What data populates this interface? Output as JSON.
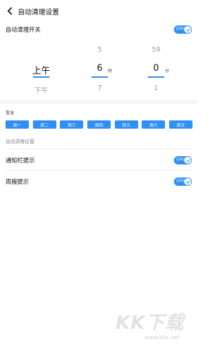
{
  "header": {
    "title": "自动清理设置",
    "back_icon": "chevron-left-icon"
  },
  "auto_clean": {
    "label": "自动清理开关",
    "toggle_text": "已开启",
    "enabled": true
  },
  "picker": {
    "period": {
      "above": "",
      "selected": "上午",
      "below": "下午"
    },
    "hour": {
      "above": "5",
      "selected": "6",
      "below": "7",
      "unit": "时"
    },
    "minute": {
      "above": "59",
      "selected": "0",
      "below": "1",
      "unit": "分"
    }
  },
  "repeat": {
    "label": "重复",
    "days": [
      "周一",
      "周二",
      "周三",
      "周四",
      "周五",
      "周六",
      "周日"
    ]
  },
  "section": {
    "title": "自动清理设置"
  },
  "notify": {
    "label": "通知栏提示",
    "toggle_text": "已开启",
    "enabled": true
  },
  "weekly": {
    "label": "周报提示",
    "toggle_text": "已开启",
    "enabled": true
  },
  "watermark": {
    "logo": "KK下载",
    "url": "www.kkx.net"
  },
  "colors": {
    "accent": "#2f8ff2",
    "band": "#f3f4f6"
  }
}
